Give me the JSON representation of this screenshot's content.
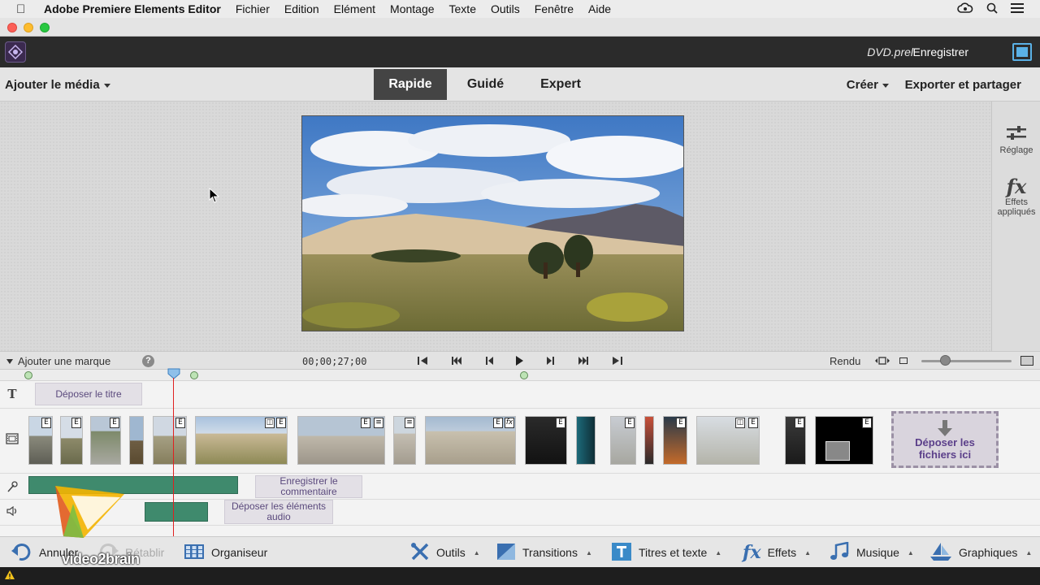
{
  "menubar": {
    "app_name": "Adobe Premiere Elements Editor",
    "items": [
      "Fichier",
      "Edition",
      "Elément",
      "Montage",
      "Texte",
      "Outils",
      "Fenêtre",
      "Aide"
    ]
  },
  "header": {
    "filename": "DVD.prel",
    "save_label": "Enregistrer"
  },
  "modebar": {
    "add_media": "Ajouter le média",
    "tabs": [
      {
        "label": "Rapide",
        "active": true
      },
      {
        "label": "Guidé",
        "active": false
      },
      {
        "label": "Expert",
        "active": false
      }
    ],
    "create": "Créer",
    "export": "Exporter et partager"
  },
  "right_panel": {
    "adjust": "Réglage",
    "effects_line1": "Effets",
    "effects_line2": "appliqués"
  },
  "transport": {
    "add_marker": "Ajouter une marque",
    "help": "?",
    "timecode": "00;00;27;00",
    "render": "Rendu"
  },
  "timeline": {
    "title_drop": "Déposer le titre",
    "narration_line1": "Enregistrer le",
    "narration_line2": "commentaire",
    "audio_drop_line1": "Déposer les éléments",
    "audio_drop_line2": "audio",
    "files_drop_line1": "Déposer les",
    "files_drop_line2": "fichiers ici"
  },
  "bottombar": {
    "undo": "Annuler",
    "redo": "Rétablir",
    "organizer": "Organiseur",
    "tools": "Outils",
    "transitions": "Transitions",
    "titles": "Titres et texte",
    "effects": "Effets",
    "music": "Musique",
    "graphics": "Graphiques"
  },
  "watermark": "video2brain",
  "colors": {
    "accent": "#444444",
    "audio_clip": "#3f8a6d",
    "playhead": "#e02020",
    "drop_text": "#5b3f8a"
  }
}
